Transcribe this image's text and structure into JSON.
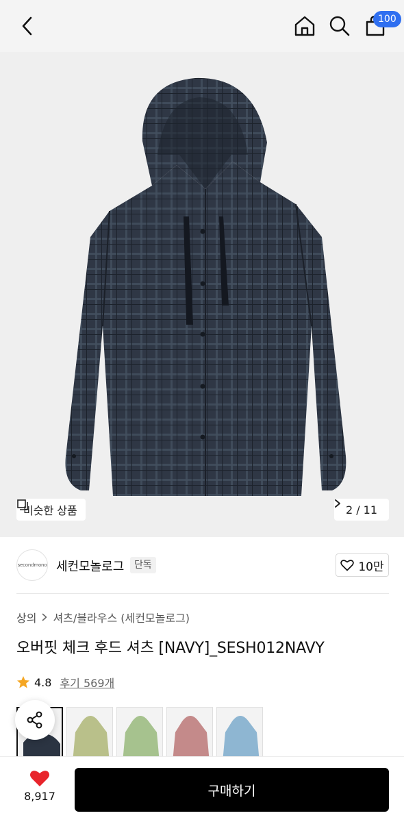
{
  "topbar": {
    "cart_badge": "100",
    "icons": [
      "chevron-left-icon",
      "home-icon",
      "search-icon",
      "bag-icon"
    ]
  },
  "gallery": {
    "similar_label": "비슷한 상품",
    "counter": "2 / 11"
  },
  "brand": {
    "logo_text": "secondmono",
    "name": "세컨모놀로그",
    "badge": "단독",
    "likes": "10만"
  },
  "breadcrumb": {
    "category": "상의",
    "subcategory": "셔츠/블라우스 (세컨모놀로그)"
  },
  "product": {
    "title": "오버핏 체크 후드 셔츠 [NAVY]_SESH012NAVY",
    "rating": "4.8",
    "reviews": "후기 569개"
  },
  "swatches": [
    {
      "name": "navy",
      "color": "#2b3442"
    },
    {
      "name": "olive",
      "color": "#b9c08a"
    },
    {
      "name": "green",
      "color": "#a6c28e"
    },
    {
      "name": "pink",
      "color": "#c48a8a"
    },
    {
      "name": "sky",
      "color": "#8eb6d2"
    }
  ],
  "bottom": {
    "wish_count": "8,917",
    "buy_label": "구매하기"
  },
  "colors": {
    "accent": "#2f6ff0",
    "heart": "#e8242b",
    "star": "#f5a623",
    "shirt": "#2f3745"
  }
}
